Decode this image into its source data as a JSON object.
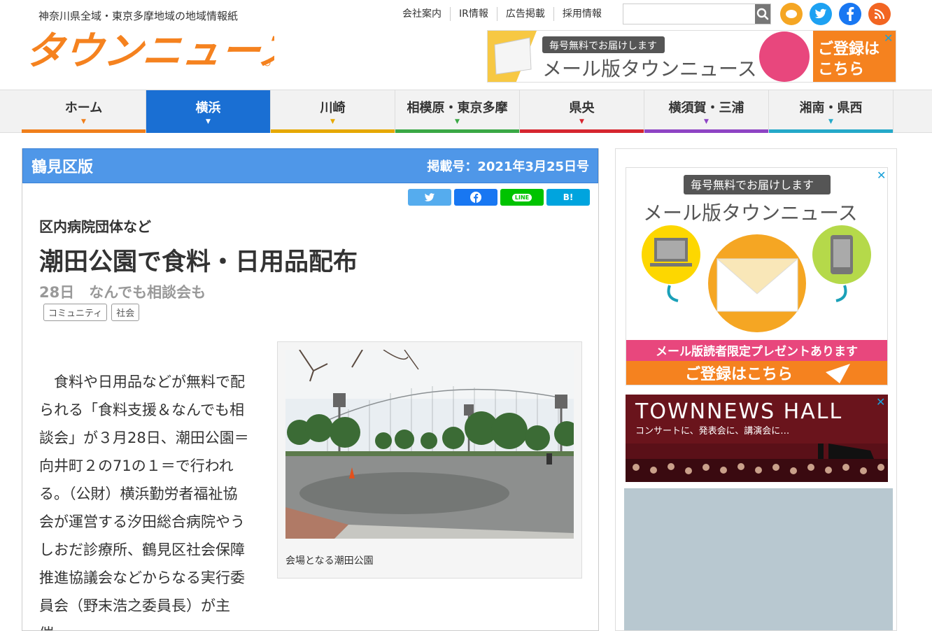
{
  "header": {
    "tagline": "神奈川県全域・東京多摩地域の地域情報紙",
    "logo_text": "タウンニュース",
    "links": [
      "会社案内",
      "IR情報",
      "広告掲載",
      "採用情報"
    ],
    "search_placeholder": "",
    "social": [
      "chat-icon",
      "twitter-icon",
      "facebook-icon",
      "rss-icon"
    ]
  },
  "top_ad": {
    "badge": "毎号無料でお届けします",
    "title": "メール版タウンニュース",
    "present": "メール版読者限定プレゼントあります",
    "cta": "ご登録はこちら"
  },
  "nav": {
    "items": [
      {
        "label": "ホーム",
        "color": "#f07f1b"
      },
      {
        "label": "横浜",
        "color": "#1a6fd3"
      },
      {
        "label": "川崎",
        "color": "#e6a800"
      },
      {
        "label": "相模原・東京多摩",
        "color": "#3aa845"
      },
      {
        "label": "県央",
        "color": "#d6262f"
      },
      {
        "label": "横須賀・三浦",
        "color": "#8e44c4"
      },
      {
        "label": "湘南・県西",
        "color": "#25a9c9"
      }
    ]
  },
  "article": {
    "edition": "鶴見区版",
    "issue_date": "掲載号：2021年3月25日号",
    "share_buttons": [
      "twitter-icon",
      "facebook-icon",
      "LINE",
      "B!"
    ],
    "kicker": "区内病院団体など",
    "headline": "潮田公園で食料・日用品配布",
    "subhead": "28日　なんでも相談会も",
    "tags": [
      "コミュニティ",
      "社会"
    ],
    "body": "食料や日用品などが無料で配られる「食料支援＆なんでも相談会」が３月28日、潮田公園＝向井町２の71の１＝で行われる。（公財）横浜勤労者福祉協会が運営する汐田総合病院やうしおだ診療所、鶴見区社会保障推進協議会などからなる実行委員会（野末浩之委員長）が主催。",
    "photo_caption": "会場となる潮田公園"
  },
  "sidebar": {
    "ad1": {
      "badge": "毎号無料でお届けします",
      "title": "メール版タウンニュース",
      "present": "メール版読者限定プレゼントあります",
      "cta": "ご登録はこちら"
    },
    "ad2": {
      "title": "TOWNNEWS HALL",
      "sub": "コンサートに、発表会に、講演会に…"
    }
  },
  "colors": {
    "edition_bar": "#4f97e8",
    "twitter": "#55acee",
    "facebook": "#1877f2",
    "line": "#00c300",
    "hatena": "#00a4de",
    "logo_orange": "#f5821f"
  }
}
